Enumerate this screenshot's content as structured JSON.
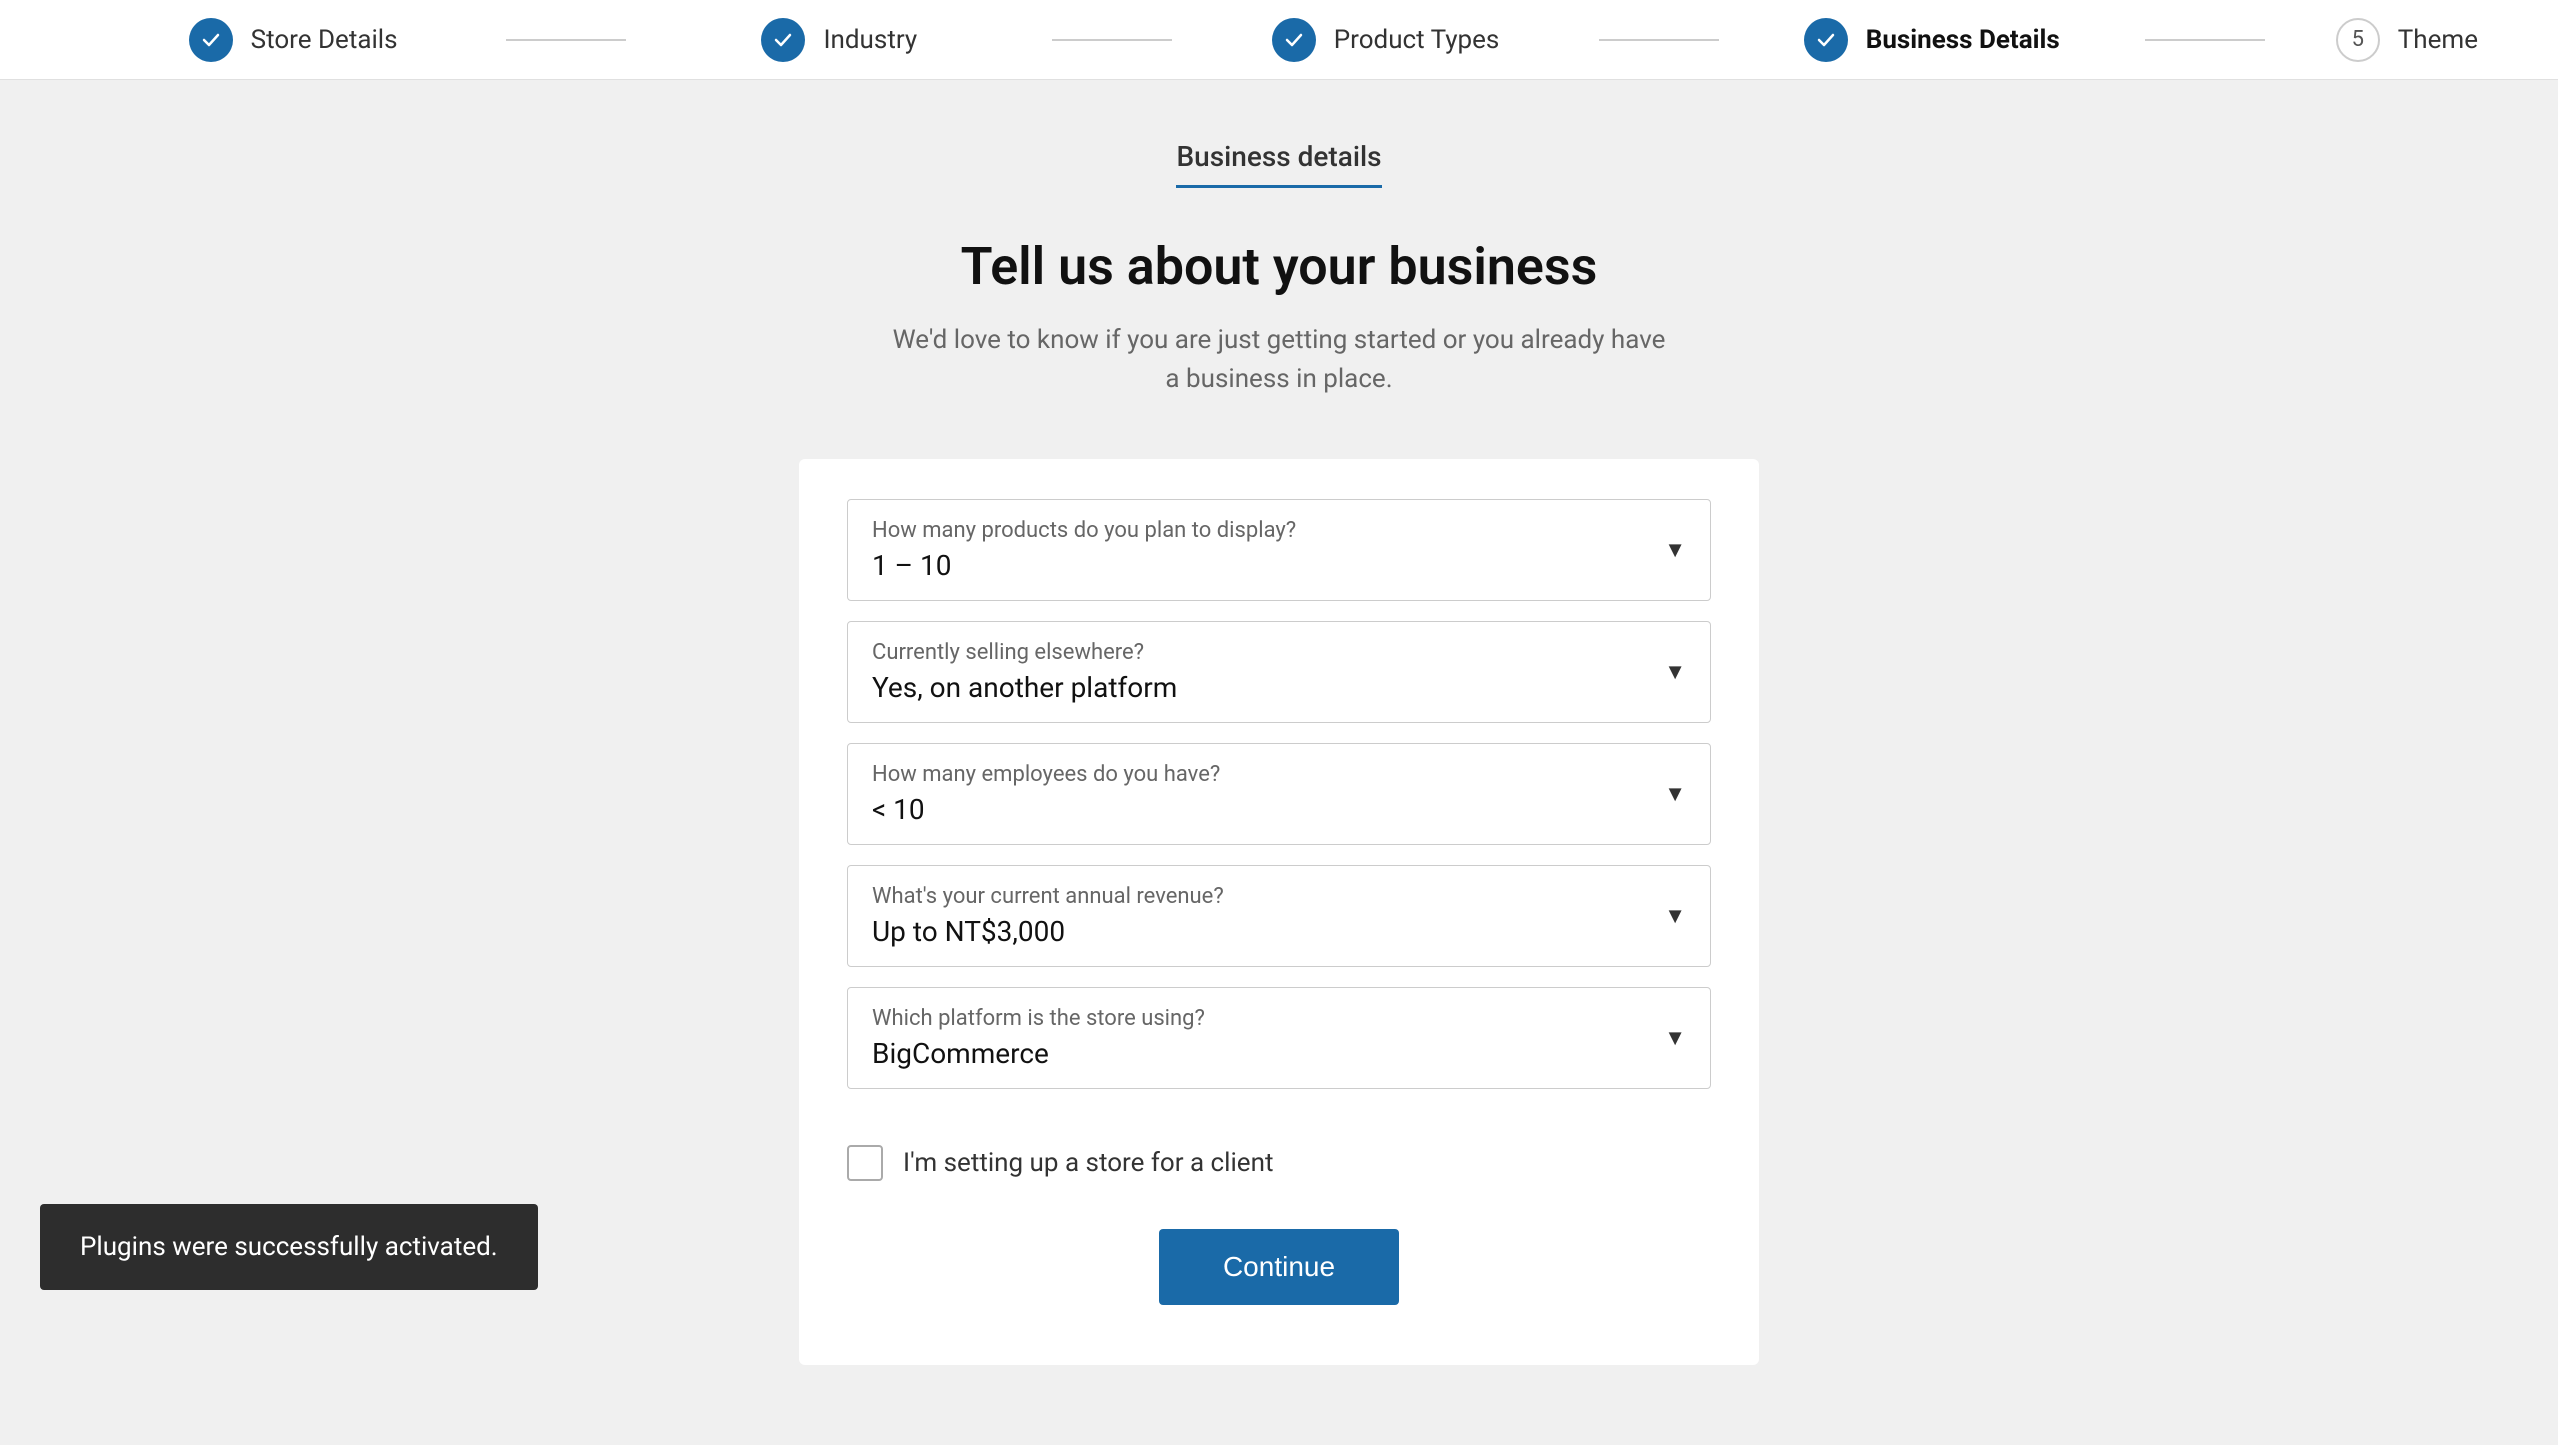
{
  "stepper": {
    "steps": [
      {
        "id": "store-details",
        "label": "Store Details",
        "type": "check",
        "active": false
      },
      {
        "id": "industry",
        "label": "Industry",
        "type": "check",
        "active": false
      },
      {
        "id": "product-types",
        "label": "Product Types",
        "type": "check",
        "active": false
      },
      {
        "id": "business-details",
        "label": "Business Details",
        "type": "check",
        "active": true
      },
      {
        "id": "theme",
        "label": "Theme",
        "type": "number",
        "number": "5",
        "active": false
      }
    ]
  },
  "page": {
    "tab_title": "Business details",
    "heading": "Tell us about your business",
    "subheading": "We'd love to know if you are just getting started or you already have a business in place."
  },
  "form": {
    "fields": [
      {
        "id": "products-count",
        "label": "How many products do you plan to display?",
        "value": "1 – 10"
      },
      {
        "id": "selling-elsewhere",
        "label": "Currently selling elsewhere?",
        "value": "Yes, on another platform"
      },
      {
        "id": "employees",
        "label": "How many employees do you have?",
        "value": "< 10"
      },
      {
        "id": "annual-revenue",
        "label": "What's your current annual revenue?",
        "value": "Up to NT$3,000"
      },
      {
        "id": "platform",
        "label": "Which platform is the store using?",
        "value": "BigCommerce"
      }
    ],
    "checkbox_label": "I'm setting up a store for a client",
    "continue_label": "Continue"
  },
  "toast": {
    "message": "Plugins were successfully activated."
  }
}
